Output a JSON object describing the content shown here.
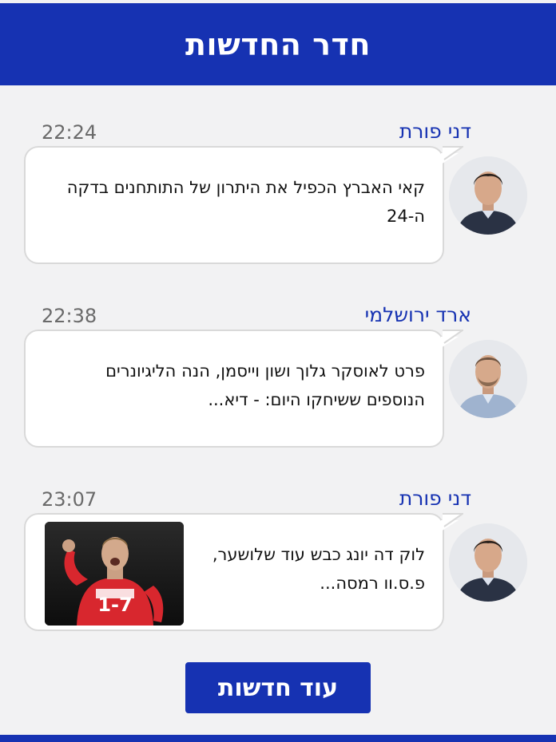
{
  "header": {
    "title": "חדר החדשות"
  },
  "items": [
    {
      "author": "דני פורת",
      "time": "22:24",
      "text": "קאי האברץ הכפיל את היתרון של התותחנים בדקה ה-24"
    },
    {
      "author": "ארד ירושלמי",
      "time": "22:38",
      "text": "פרט לאוסקר גלוך ושון וייסמן, הנה הליגיונרים הנוספים ששיחקו היום: - דיא..."
    },
    {
      "author": "דני פורת",
      "time": "23:07",
      "text": "לוק דה יונג כבש עוד שלושער, פ.ס.וו רמסה...",
      "image_caption": "1-7"
    }
  ],
  "more_button": "עוד חדשות",
  "colors": {
    "brand": "#1632b2",
    "background": "#f2f2f3"
  }
}
